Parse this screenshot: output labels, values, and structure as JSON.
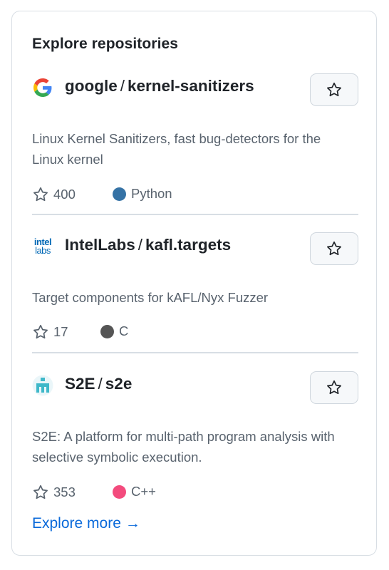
{
  "widget": {
    "title": "Explore repositories",
    "explore_more": "Explore more",
    "explore_more_arrow": "→"
  },
  "repos": [
    {
      "owner": "google",
      "separator": "/",
      "name": "kernel-sanitizers",
      "description": "Linux Kernel Sanitizers, fast bug-detectors for the Linux kernel",
      "stars": "400",
      "language": "Python",
      "language_color": "#3572A5",
      "avatar": "google-logo"
    },
    {
      "owner": "IntelLabs",
      "separator": "/",
      "name": "kafl.targets",
      "description": "Target components for kAFL/Nyx Fuzzer",
      "stars": "17",
      "language": "C",
      "language_color": "#555555",
      "avatar": "intel-labs-logo",
      "avatar_text_1": "intel",
      "avatar_text_2": "labs"
    },
    {
      "owner": "S2E",
      "separator": "/",
      "name": "s2e",
      "description": "S2E: A platform for multi-path program analysis with selective symbolic execution.",
      "stars": "353",
      "language": "C++",
      "language_color": "#f34b7d",
      "avatar": "s2e-logo"
    }
  ],
  "icons": {
    "star": "star-icon",
    "arrow": "arrow-right-icon"
  }
}
